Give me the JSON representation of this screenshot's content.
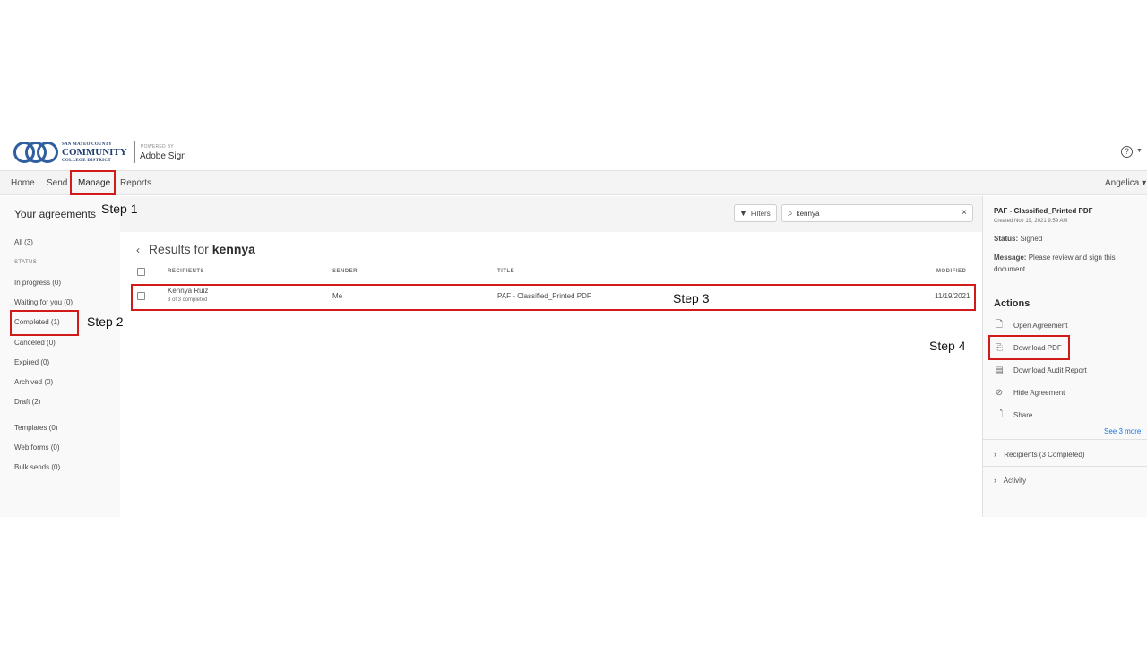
{
  "header": {
    "logo": {
      "line1": "SAN MATEO COUNTY",
      "line2": "COMMUNITY",
      "line3": "COLLEGE DISTRICT"
    },
    "powered_by": "POWERED BY",
    "product": "Adobe Sign",
    "help_icon": "?"
  },
  "nav": {
    "items": [
      "Home",
      "Send",
      "Manage",
      "Reports"
    ],
    "active": "Manage",
    "user": "Angelica ▾"
  },
  "sidebar": {
    "title": "Your agreements",
    "all": "All (3)",
    "status_label": "STATUS",
    "statuses": [
      "In progress (0)",
      "Waiting for you (0)",
      "Completed (1)",
      "Canceled (0)",
      "Expired (0)",
      "Archived (0)",
      "Draft (2)"
    ],
    "other": [
      "Templates (0)",
      "Web forms (0)",
      "Bulk sends (0)"
    ]
  },
  "toolbar": {
    "filters_label": "Filters",
    "search_value": "kennya",
    "search_icon": "search-icon"
  },
  "results": {
    "prefix": "Results for",
    "query": "kennya"
  },
  "table": {
    "headers": [
      "RECIPIENTS",
      "SENDER",
      "TITLE",
      "MODIFIED"
    ],
    "rows": [
      {
        "recipient": "Kennya Ruiz",
        "recipient_sub": "3 of 3 completed",
        "sender": "Me",
        "title": "PAF - Classified_Printed PDF",
        "modified": "11/19/2021"
      }
    ]
  },
  "detail": {
    "title": "PAF - Classified_Printed PDF",
    "created": "Created Nov 19, 2021 9:59 AM",
    "status_label": "Status:",
    "status_value": "Signed",
    "message_label": "Message:",
    "message_value": "Please review and sign this document.",
    "actions_title": "Actions",
    "actions": [
      "Open Agreement",
      "Download PDF",
      "Download Audit Report",
      "Hide Agreement",
      "Share"
    ],
    "see_more": "See 3 more",
    "recipients": "Recipients (3 Completed)",
    "activity": "Activity"
  },
  "annotations": {
    "step1": "Step 1",
    "step2": "Step 2",
    "step3": "Step 3",
    "step4": "Step 4",
    "color": "#d11a1a"
  }
}
